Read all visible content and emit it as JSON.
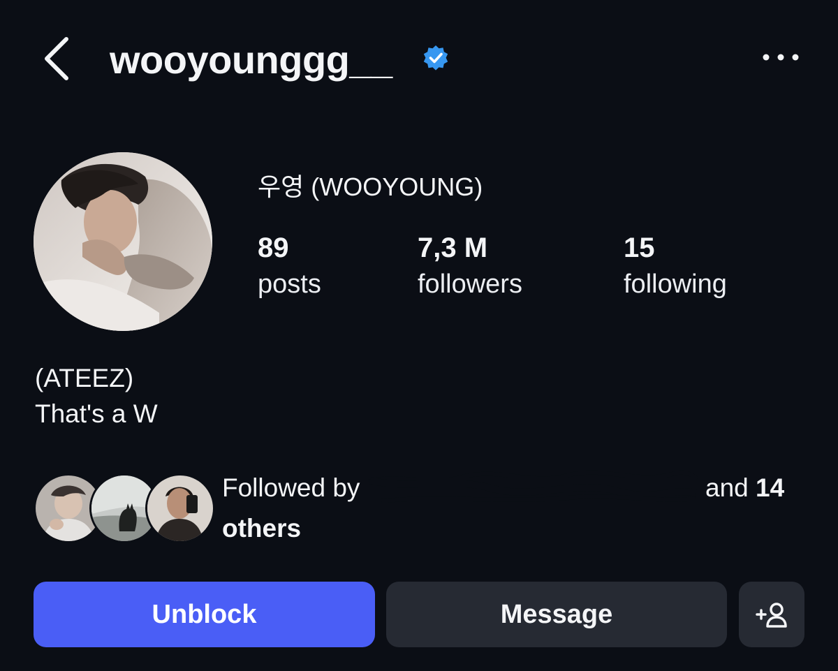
{
  "header": {
    "back_icon": "chevron-left-icon",
    "username": "wooyounggg__",
    "verified_icon": "verified-badge-icon",
    "more_icon": "more-horizontal-icon"
  },
  "profile": {
    "display_name": "우영 (WOOYOUNG)",
    "stats": {
      "posts": {
        "value": "89",
        "label": "posts"
      },
      "followers": {
        "value": "7,3 M",
        "label": "followers"
      },
      "following": {
        "value": "15",
        "label": "following"
      }
    },
    "bio": {
      "line1": "(ATEEZ)",
      "line2": "That's a W"
    }
  },
  "mutual": {
    "prefix": "Followed by",
    "visible_tail": "and",
    "count_text": "14",
    "line2": "others"
  },
  "actions": {
    "unblock_label": "Unblock",
    "message_label": "Message",
    "add_user_icon": "add-user-icon"
  },
  "colors": {
    "background": "#0b0e15",
    "primary_button": "#4a5ef6",
    "secondary_button": "#262a33",
    "verified_blue": "#3797f0"
  }
}
